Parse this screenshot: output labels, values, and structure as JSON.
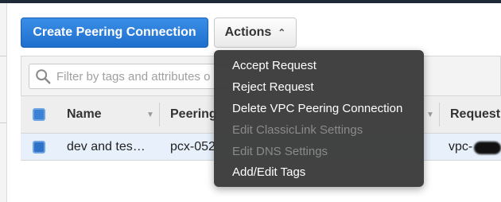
{
  "toolbar": {
    "create_label": "Create Peering Connection",
    "actions_label": "Actions",
    "actions_caret": "⌃"
  },
  "search": {
    "placeholder": "Filter by tags and attributes o"
  },
  "table": {
    "columns": [
      "Name",
      "Peering",
      "Request"
    ],
    "rows": [
      {
        "name": "dev and tes…",
        "peering": "pcx-052",
        "request": "vpc-"
      }
    ]
  },
  "actions_menu": {
    "items": [
      {
        "label": "Accept Request",
        "enabled": true
      },
      {
        "label": "Reject Request",
        "enabled": true
      },
      {
        "label": "Delete VPC Peering Connection",
        "enabled": true
      },
      {
        "label": "Edit ClassicLink Settings",
        "enabled": false
      },
      {
        "label": "Edit DNS Settings",
        "enabled": false
      },
      {
        "label": "Add/Edit Tags",
        "enabled": true
      }
    ]
  },
  "colors": {
    "primary": "#1f6fce",
    "menu_bg": "#3a3a3a",
    "disabled_text": "#8a8a8a",
    "selected_row": "#e8f1fb"
  },
  "icons": {
    "search": "magnifier-icon",
    "sort": "sort-caret-icon"
  }
}
